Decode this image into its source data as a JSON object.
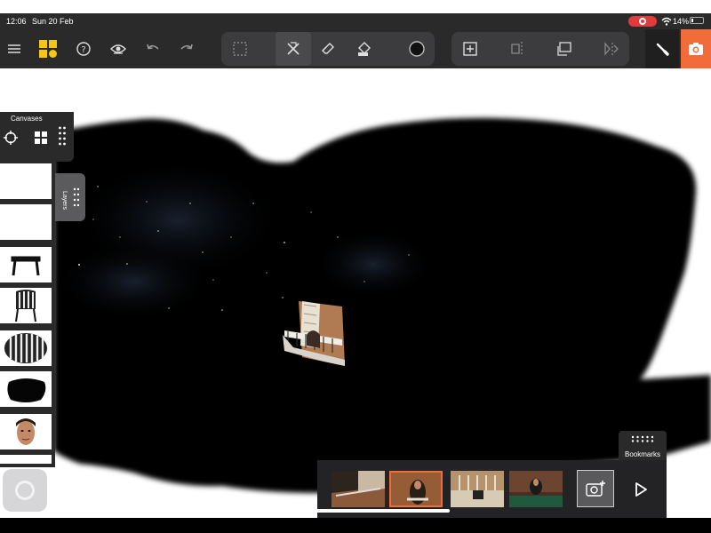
{
  "status_bar": {
    "time": "12:06",
    "date": "Sun 20 Feb",
    "battery": "14%"
  },
  "toolbar": {
    "left_icons": [
      "menu-icon",
      "app-logo",
      "help-icon",
      "view-eye-icon",
      "undo-icon",
      "redo-icon"
    ],
    "center_group_1": [
      "select-marquee-icon",
      "remove-object-icon",
      "eraser-icon",
      "fill-bucket-icon",
      "color-swatch-icon"
    ],
    "center_group_2": [
      "add-layer-icon",
      "align-icon",
      "transform-icon",
      "flip-icon"
    ],
    "right_tools": [
      "brush-icon",
      "camera-icon"
    ],
    "accent_color": "#f26b3a",
    "logo_color": "#f5c518"
  },
  "canvases_panel": {
    "title": "Canvases"
  },
  "layers_panel": {
    "label": "Layers",
    "thumbnails": [
      "layer-blank-1",
      "layer-blank-2",
      "layer-table",
      "layer-chair",
      "layer-striped-cushion",
      "layer-black-blob",
      "layer-face"
    ]
  },
  "bookmarks": {
    "label": "Bookmarks"
  },
  "film_strip": {
    "frames": [
      "frame-1",
      "frame-2",
      "frame-3",
      "frame-4"
    ],
    "selected_frame": 2
  }
}
